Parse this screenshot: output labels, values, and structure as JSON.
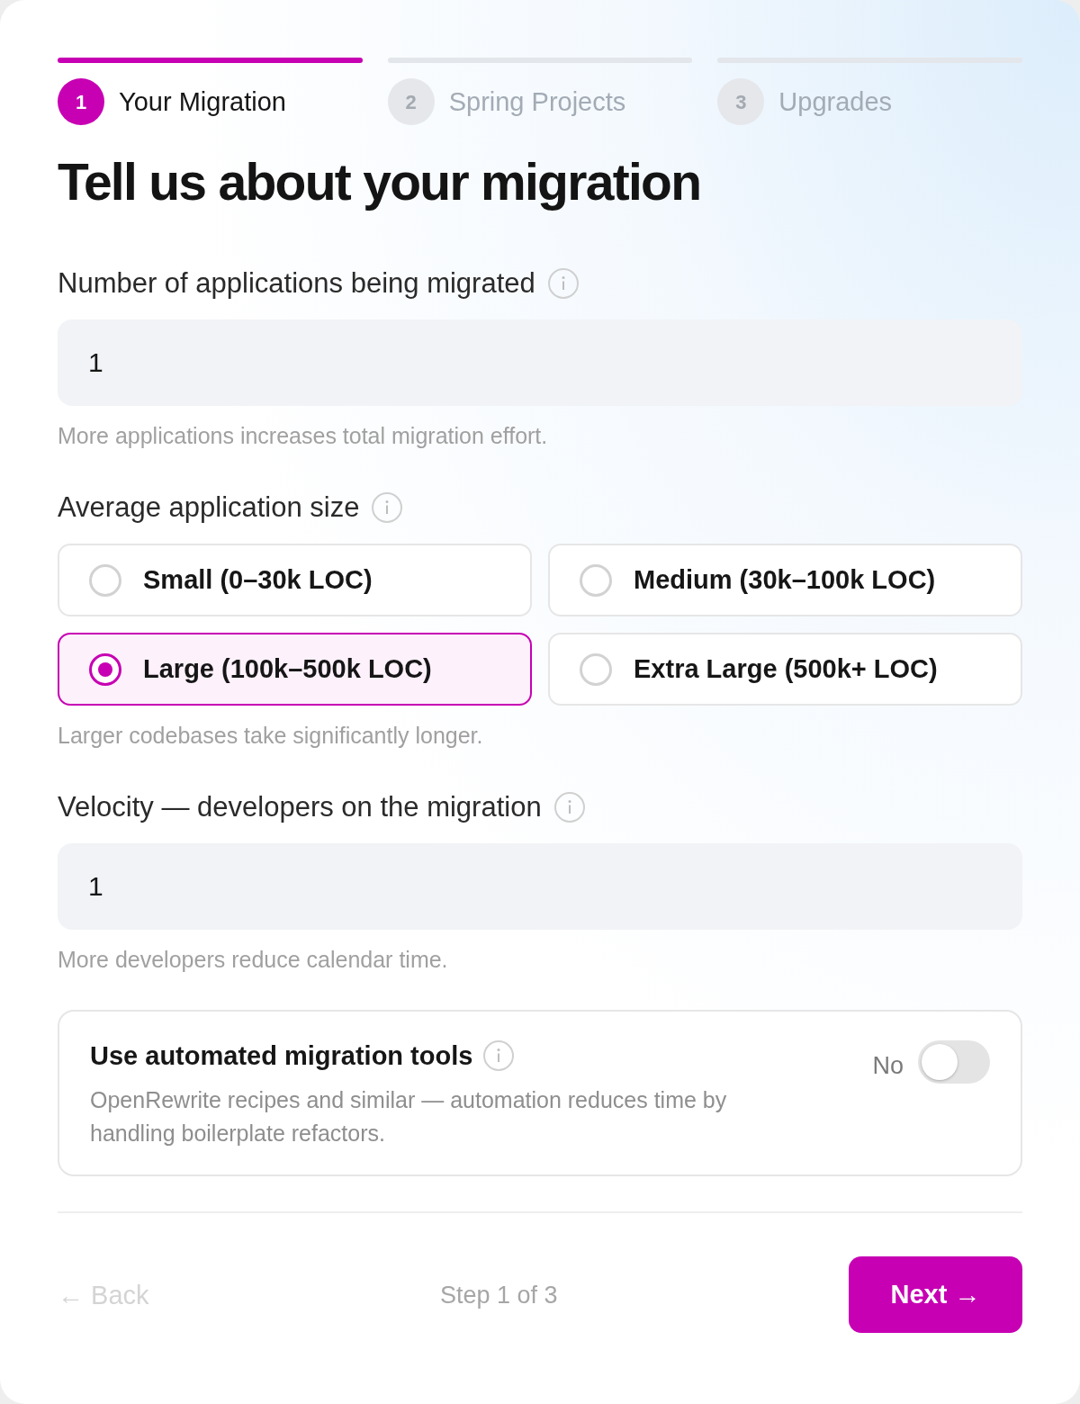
{
  "stepper": {
    "steps": [
      {
        "number": "1",
        "label": "Your Migration",
        "selected": true
      },
      {
        "number": "2",
        "label": "Spring Projects",
        "selected": false
      },
      {
        "number": "3",
        "label": "Upgrades",
        "selected": false
      }
    ]
  },
  "heading": "Tell us about your migration",
  "fields": [
    {
      "kind": "number",
      "label": "Number of applications being migrated",
      "value": "1",
      "hint": "More applications increases total migration effort."
    },
    {
      "kind": "choice",
      "label": "Average application size",
      "options": [
        {
          "label": "Small (0–30k LOC)",
          "selected": false
        },
        {
          "label": "Medium (30k–100k LOC)",
          "selected": false
        },
        {
          "label": "Large (100k–500k LOC)",
          "selected": true
        },
        {
          "label": "Extra Large (500k+ LOC)",
          "selected": false
        }
      ],
      "hint": "Larger codebases take significantly longer."
    },
    {
      "kind": "number",
      "label": "Velocity — developers on the migration",
      "value": "1",
      "hint": "More developers reduce calendar time."
    }
  ],
  "automation": {
    "title": "Use automated migration tools",
    "description": "OpenRewrite recipes and similar — automation reduces time by handling boilerplate refactors.",
    "state_label": "No",
    "on": false
  },
  "footer": {
    "back": {
      "label": "← Back",
      "disabled": true
    },
    "step": "Step 1 of 3",
    "next": "Next →"
  }
}
